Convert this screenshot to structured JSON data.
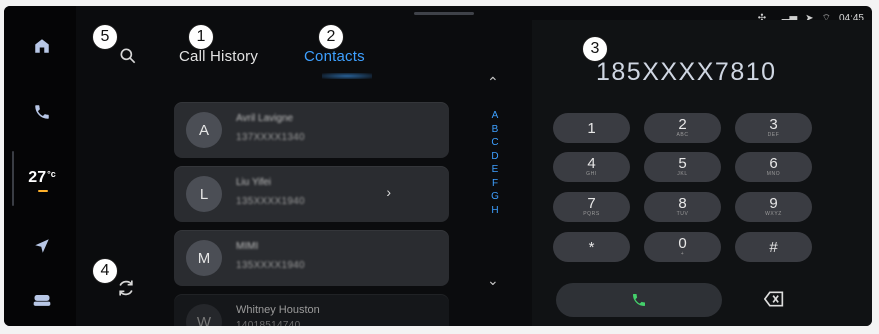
{
  "status": {
    "time": "04:45"
  },
  "tabs": {
    "call_history": "Call History",
    "contacts": "Contacts"
  },
  "contacts": [
    {
      "initial": "A",
      "name": "Avril Lavigne",
      "number": "137XXXX1340"
    },
    {
      "initial": "L",
      "name": "Liu Yifei",
      "number": "135XXXX1940"
    },
    {
      "initial": "M",
      "name": "MIMI",
      "number": "135XXXX1940"
    },
    {
      "initial": "W",
      "name": "Whitney Houston",
      "number": "14018514740"
    }
  ],
  "alphabet": [
    "A",
    "B",
    "C",
    "D",
    "E",
    "F",
    "G",
    "H"
  ],
  "dialpad": {
    "number": "185XXXX7810",
    "keys": [
      {
        "digit": "1",
        "letters": ""
      },
      {
        "digit": "2",
        "letters": "ABC"
      },
      {
        "digit": "3",
        "letters": "DEF"
      },
      {
        "digit": "4",
        "letters": "GHI"
      },
      {
        "digit": "5",
        "letters": "JKL"
      },
      {
        "digit": "6",
        "letters": "MNO"
      },
      {
        "digit": "7",
        "letters": "PQRS"
      },
      {
        "digit": "8",
        "letters": "TUV"
      },
      {
        "digit": "9",
        "letters": "WXYZ"
      },
      {
        "digit": "*",
        "letters": ""
      },
      {
        "digit": "0",
        "letters": "+"
      },
      {
        "digit": "#",
        "letters": ""
      }
    ]
  },
  "sidebar": {
    "temperature": "27",
    "temperature_unit": "°c",
    "accent": "#ffb12b"
  },
  "callouts": [
    "1",
    "2",
    "3",
    "4",
    "5"
  ],
  "colors": {
    "accent_blue": "#3ea0ff",
    "call_green": "#44d06b"
  },
  "icons": {
    "home": "home-icon",
    "phone": "phone-icon",
    "navigation": "navigation-arrow-icon",
    "vehicle": "car-seat-icon",
    "search": "search-icon",
    "refresh": "refresh-icon",
    "backspace": "backspace-icon",
    "call": "phone-icon"
  }
}
